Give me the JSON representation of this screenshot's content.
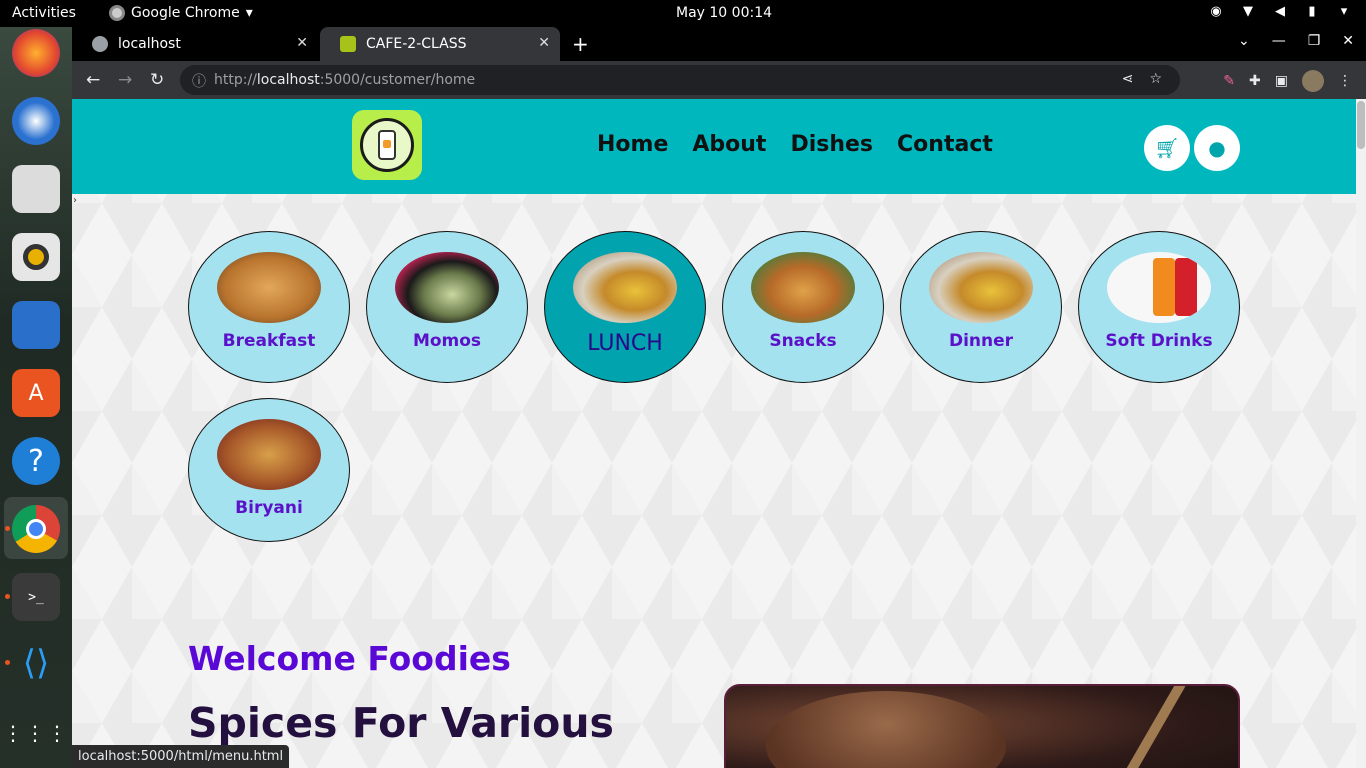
{
  "system": {
    "activities": "Activities",
    "app_name": "Google Chrome",
    "clock": "May 10  00:14"
  },
  "browser": {
    "tabs": [
      {
        "title": "localhost",
        "active": false
      },
      {
        "title": "CAFE-2-CLASS",
        "active": true
      }
    ],
    "url_prefix": "http://",
    "url_host": "localhost",
    "url_rest": ":5000/customer/home",
    "status_url": "localhost:5000/html/menu.html"
  },
  "site": {
    "nav": [
      "Home",
      "About",
      "Dishes",
      "Contact"
    ],
    "categories": [
      {
        "label": "Breakfast",
        "active": false
      },
      {
        "label": "Momos",
        "active": false
      },
      {
        "label": "LUNCH",
        "active": true
      },
      {
        "label": "Snacks",
        "active": false
      },
      {
        "label": "Dinner",
        "active": false
      },
      {
        "label": "Soft Drinks",
        "active": false
      },
      {
        "label": "Biryani",
        "active": false
      }
    ],
    "welcome": "Welcome Foodies",
    "headline": "Spices For Various",
    "colors": {
      "header_bg": "#00b7bd",
      "category_bg": "#a5e2ef",
      "category_active_bg": "#00a3ae",
      "category_label": "#5b10c9",
      "welcome_color": "#5a08d6"
    },
    "icons": {
      "cart": "cart-icon",
      "user": "user-icon"
    }
  }
}
